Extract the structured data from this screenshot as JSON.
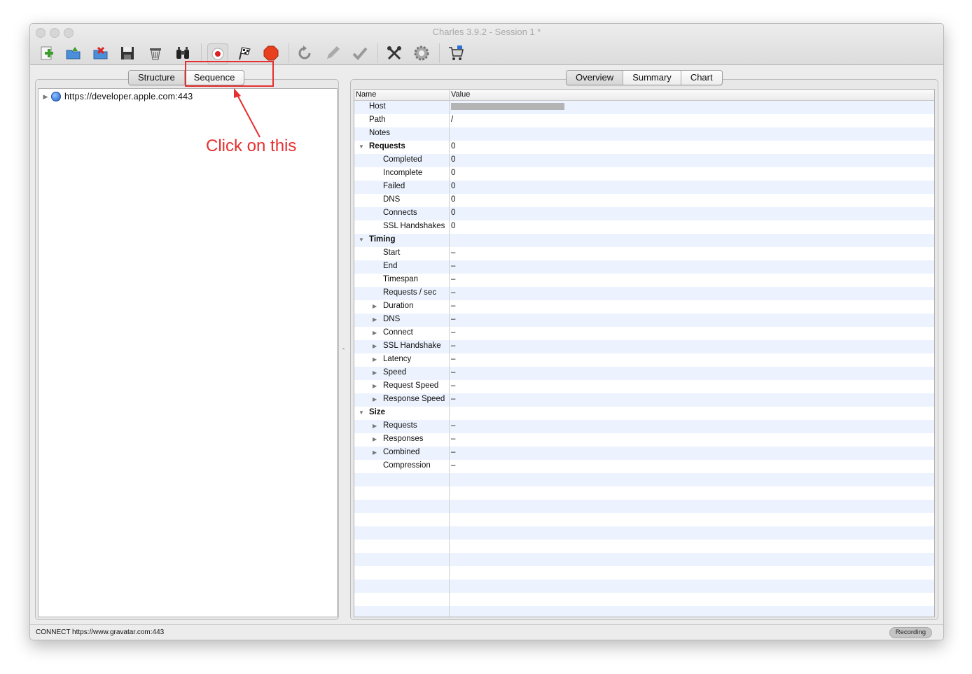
{
  "window": {
    "title": "Charles 3.9.2 - Session 1 *"
  },
  "toolbar": {
    "icons": [
      "new-session-icon",
      "open-session-icon",
      "close-session-icon",
      "save-session-icon",
      "clear-session-icon",
      "find-icon",
      "record-icon",
      "throttle-icon",
      "breakpoints-icon",
      "repeat-icon",
      "edit-icon",
      "validate-icon",
      "tools-icon",
      "settings-icon",
      "cart-icon"
    ]
  },
  "left_pane": {
    "tabs": [
      "Structure",
      "Sequence"
    ],
    "active_tab": "Structure",
    "tree_items": [
      {
        "label": "https://developer.apple.com:443"
      }
    ]
  },
  "right_pane": {
    "tabs": [
      "Overview",
      "Summary",
      "Chart"
    ],
    "active_tab": "Overview",
    "columns": {
      "name": "Name",
      "value": "Value"
    },
    "rows": [
      {
        "name": "Host",
        "value": "",
        "redacted": true
      },
      {
        "name": "Path",
        "value": "/"
      },
      {
        "name": "Notes",
        "value": ""
      },
      {
        "name": "Requests",
        "value": "0",
        "group": true
      },
      {
        "name": "Completed",
        "value": "0"
      },
      {
        "name": "Incomplete",
        "value": "0"
      },
      {
        "name": "Failed",
        "value": "0"
      },
      {
        "name": "DNS",
        "value": "0"
      },
      {
        "name": "Connects",
        "value": "0"
      },
      {
        "name": "SSL Handshakes",
        "value": "0"
      },
      {
        "name": "Timing",
        "value": "",
        "group": true
      },
      {
        "name": "Start",
        "value": "–"
      },
      {
        "name": "End",
        "value": "–"
      },
      {
        "name": "Timespan",
        "value": "–"
      },
      {
        "name": "Requests / sec",
        "value": "–"
      },
      {
        "name": "Duration",
        "value": "–",
        "expandable": true
      },
      {
        "name": "DNS",
        "value": "–",
        "expandable": true
      },
      {
        "name": "Connect",
        "value": "–",
        "expandable": true
      },
      {
        "name": "SSL Handshake",
        "value": "–",
        "expandable": true
      },
      {
        "name": "Latency",
        "value": "–",
        "expandable": true
      },
      {
        "name": "Speed",
        "value": "–",
        "expandable": true
      },
      {
        "name": "Request Speed",
        "value": "–",
        "expandable": true
      },
      {
        "name": "Response Speed",
        "value": "–",
        "expandable": true
      },
      {
        "name": "Size",
        "value": "",
        "group": true
      },
      {
        "name": "Requests",
        "value": "–",
        "expandable": true
      },
      {
        "name": "Responses",
        "value": "–",
        "expandable": true
      },
      {
        "name": "Combined",
        "value": "–",
        "expandable": true
      },
      {
        "name": "Compression",
        "value": "–"
      }
    ]
  },
  "status_bar": {
    "text": "CONNECT https://www.gravatar.com:443",
    "badge": "Recording"
  },
  "annotation": {
    "text": "Click on this",
    "color": "#e62f2f"
  }
}
